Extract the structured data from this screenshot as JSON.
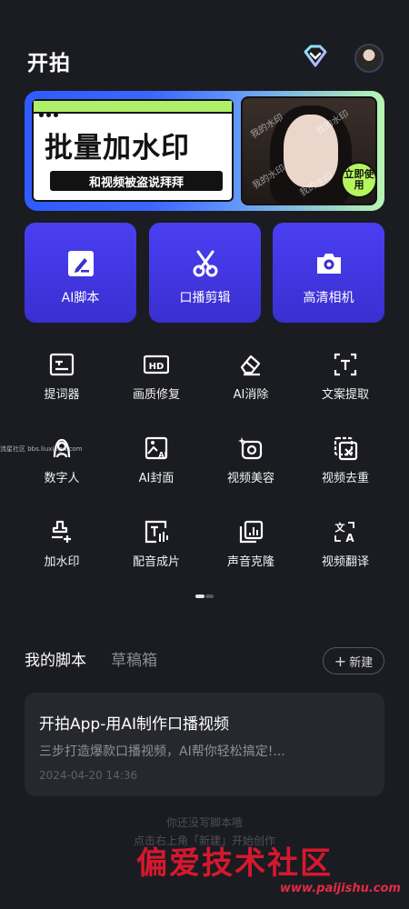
{
  "header": {
    "title": "开拍",
    "diamond_icon": "diamond-vip-icon",
    "avatar_icon": "user-avatar"
  },
  "banner": {
    "title": "批量加水印",
    "subtitle": "和视频被盗说拜拜",
    "watermark": "我的水印",
    "badge": "立即使用"
  },
  "quick_actions": [
    {
      "label": "AI脚本",
      "icon": "pen-icon"
    },
    {
      "label": "口播剪辑",
      "icon": "scissors-icon"
    },
    {
      "label": "高清相机",
      "icon": "camera-icon"
    }
  ],
  "tools": [
    {
      "label": "提词器",
      "icon": "teleprompter-icon"
    },
    {
      "label": "画质修复",
      "icon": "hd-icon"
    },
    {
      "label": "AI消除",
      "icon": "eraser-icon"
    },
    {
      "label": "文案提取",
      "icon": "text-extract-icon"
    },
    {
      "label": "数字人",
      "icon": "digital-human-icon"
    },
    {
      "label": "AI封面",
      "icon": "ai-cover-icon"
    },
    {
      "label": "视频美容",
      "icon": "beauty-icon"
    },
    {
      "label": "视频去重",
      "icon": "dedupe-icon"
    },
    {
      "label": "加水印",
      "icon": "add-watermark-icon"
    },
    {
      "label": "配音成片",
      "icon": "dubbing-icon"
    },
    {
      "label": "声音克隆",
      "icon": "voice-clone-icon"
    },
    {
      "label": "视频翻译",
      "icon": "translate-icon"
    }
  ],
  "pager": {
    "count": 2,
    "active": 0
  },
  "tabs": {
    "active": "我的脚本",
    "inactive": "草稿箱"
  },
  "new_button": {
    "label": "新建"
  },
  "script_card": {
    "title": "开拍App-用AI制作口播视频",
    "description": "三步打造爆款口播视频，AI帮你轻松搞定!...",
    "time": "2024-04-20 14:36"
  },
  "empty_state": {
    "line1": "你还没写脚本哦",
    "line2": "点击右上角「新建」开始创作"
  },
  "watermark_footer": {
    "brand": "偏爱技术社区",
    "url": "www.paijishu.com"
  },
  "side_watermark": "流星社区 bbs.liuxingw.com",
  "colors": {
    "background": "#1b1c21",
    "accent": "#4a3ff2",
    "card": "#27282e"
  }
}
